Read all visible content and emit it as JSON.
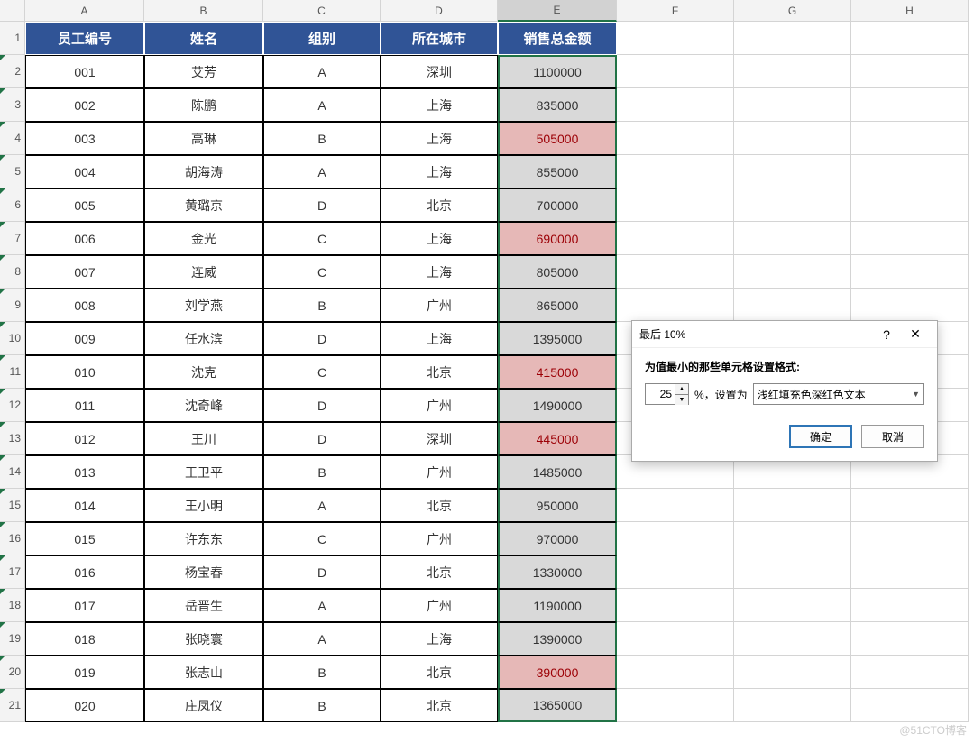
{
  "columns": [
    "A",
    "B",
    "C",
    "D",
    "E",
    "F",
    "G",
    "H"
  ],
  "selected_col": "E",
  "headers": {
    "emp_no": "员工编号",
    "name": "姓名",
    "group": "组别",
    "city": "所在城市",
    "sales": "销售总金额"
  },
  "rows": [
    {
      "no": "001",
      "name": "艾芳",
      "group": "A",
      "city": "深圳",
      "sales": "1100000",
      "hl": false
    },
    {
      "no": "002",
      "name": "陈鹏",
      "group": "A",
      "city": "上海",
      "sales": "835000",
      "hl": false
    },
    {
      "no": "003",
      "name": "高琳",
      "group": "B",
      "city": "上海",
      "sales": "505000",
      "hl": true
    },
    {
      "no": "004",
      "name": "胡海涛",
      "group": "A",
      "city": "上海",
      "sales": "855000",
      "hl": false
    },
    {
      "no": "005",
      "name": "黄璐京",
      "group": "D",
      "city": "北京",
      "sales": "700000",
      "hl": false
    },
    {
      "no": "006",
      "name": "金光",
      "group": "C",
      "city": "上海",
      "sales": "690000",
      "hl": true
    },
    {
      "no": "007",
      "name": "连威",
      "group": "C",
      "city": "上海",
      "sales": "805000",
      "hl": false
    },
    {
      "no": "008",
      "name": "刘学燕",
      "group": "B",
      "city": "广州",
      "sales": "865000",
      "hl": false
    },
    {
      "no": "009",
      "name": "任水滨",
      "group": "D",
      "city": "上海",
      "sales": "1395000",
      "hl": false
    },
    {
      "no": "010",
      "name": "沈克",
      "group": "C",
      "city": "北京",
      "sales": "415000",
      "hl": true
    },
    {
      "no": "011",
      "name": "沈奇峰",
      "group": "D",
      "city": "广州",
      "sales": "1490000",
      "hl": false
    },
    {
      "no": "012",
      "name": "王川",
      "group": "D",
      "city": "深圳",
      "sales": "445000",
      "hl": true
    },
    {
      "no": "013",
      "name": "王卫平",
      "group": "B",
      "city": "广州",
      "sales": "1485000",
      "hl": false
    },
    {
      "no": "014",
      "name": "王小明",
      "group": "A",
      "city": "北京",
      "sales": "950000",
      "hl": false
    },
    {
      "no": "015",
      "name": "许东东",
      "group": "C",
      "city": "广州",
      "sales": "970000",
      "hl": false
    },
    {
      "no": "016",
      "name": "杨宝春",
      "group": "D",
      "city": "北京",
      "sales": "1330000",
      "hl": false
    },
    {
      "no": "017",
      "name": "岳晋生",
      "group": "A",
      "city": "广州",
      "sales": "1190000",
      "hl": false
    },
    {
      "no": "018",
      "name": "张晓寰",
      "group": "A",
      "city": "上海",
      "sales": "1390000",
      "hl": false
    },
    {
      "no": "019",
      "name": "张志山",
      "group": "B",
      "city": "北京",
      "sales": "390000",
      "hl": true
    },
    {
      "no": "020",
      "name": "庄凤仪",
      "group": "B",
      "city": "北京",
      "sales": "1365000",
      "hl": false
    }
  ],
  "dialog": {
    "title": "最后 10%",
    "help": "?",
    "close": "✕",
    "prompt": "为值最小的那些单元格设置格式:",
    "percent_value": "25",
    "percent_label": "%，设置为",
    "format_option": "浅红填充色深红色文本",
    "ok": "确定",
    "cancel": "取消"
  },
  "watermark": "@51CTO博客"
}
